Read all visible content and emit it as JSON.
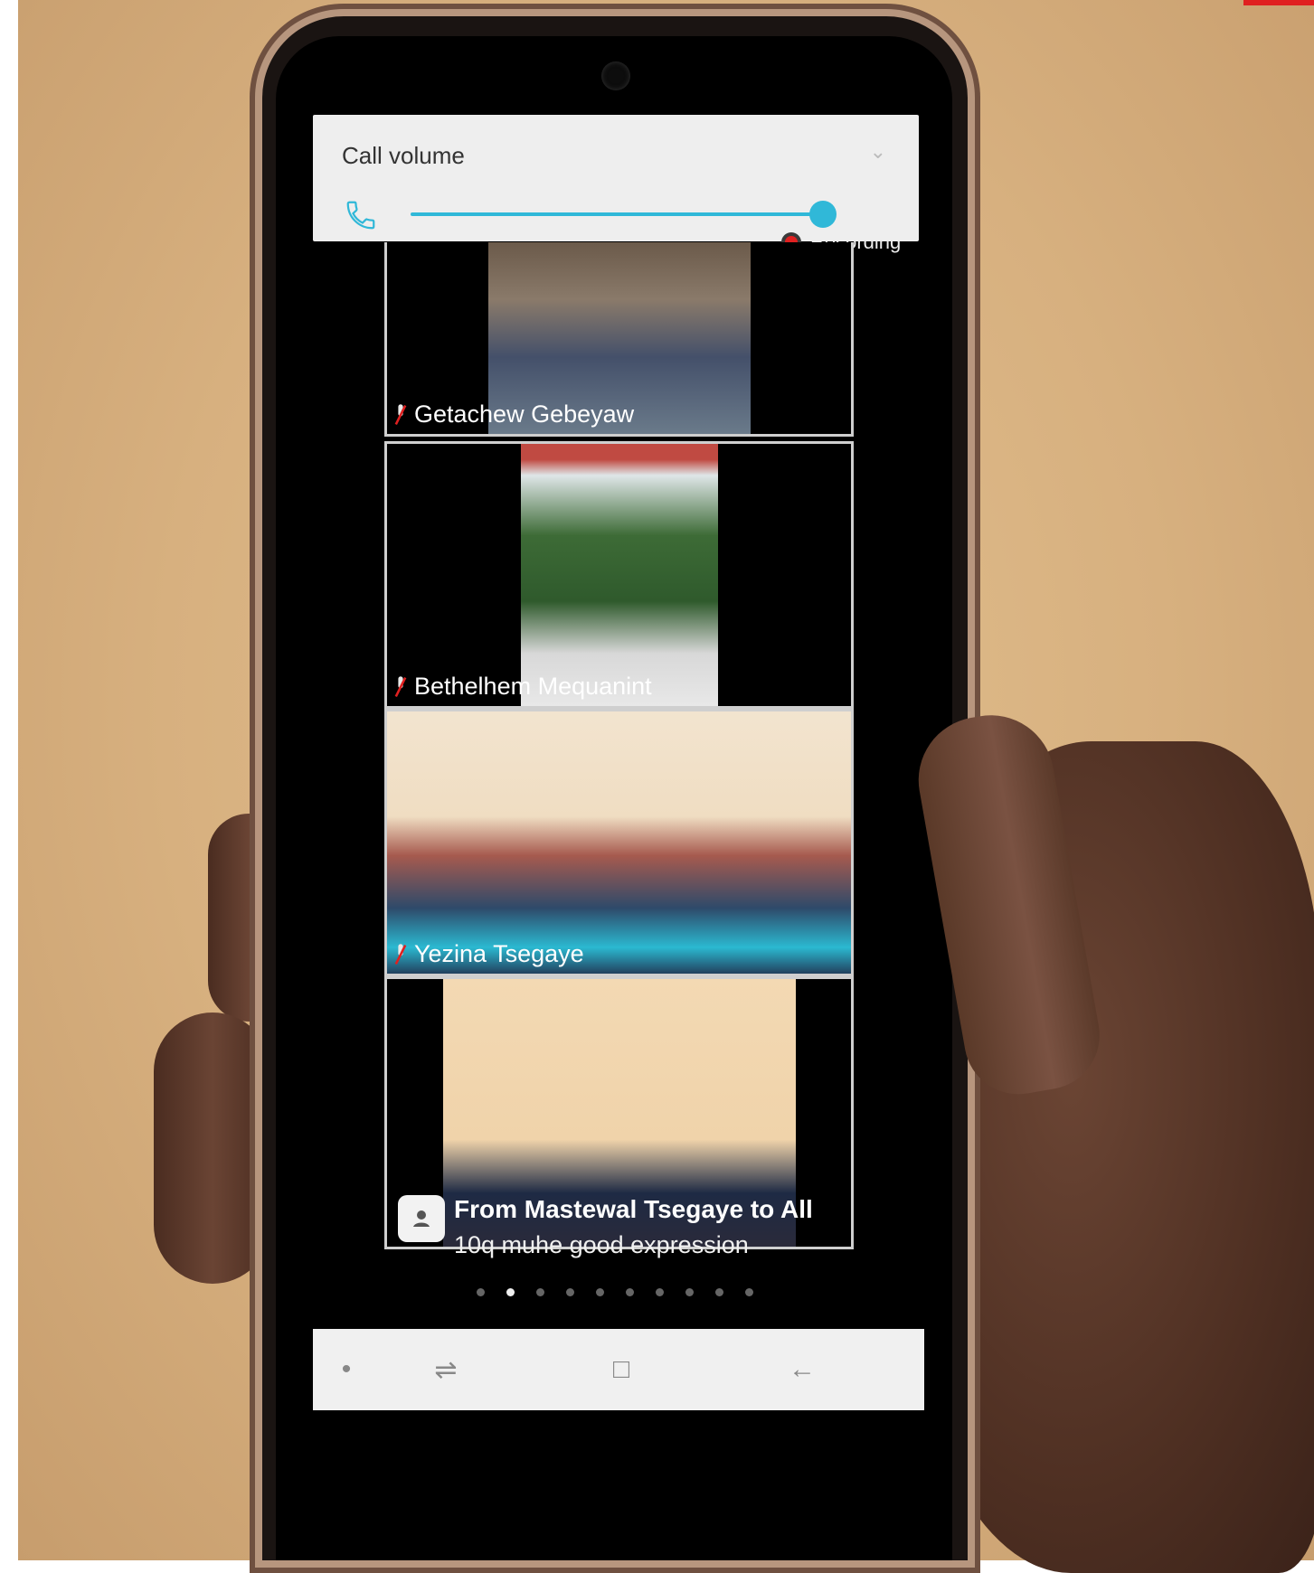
{
  "volume_panel": {
    "title": "Call volume",
    "level_percent": 97,
    "icons": {
      "phone": "phone-icon",
      "collapse": "chevron-down-icon"
    }
  },
  "recording": {
    "label": "Recording"
  },
  "participants": [
    {
      "name": "Getachew Gebeyaw"
    },
    {
      "name": "Bethelhem Mequanint"
    },
    {
      "name": "Yezina Tsegaye"
    },
    {
      "name": ""
    }
  ],
  "chat_notification": {
    "sender": "From Mastewal Tsegaye to All",
    "message": "10q muhe good expression"
  },
  "pagination": {
    "total_pages": 10,
    "current_page": 2
  },
  "nav_bar": {
    "icons": [
      "dot-icon",
      "recent-apps-icon",
      "home-icon",
      "back-icon"
    ]
  },
  "colors": {
    "accent": "#30b8d8",
    "recording": "#e02020"
  }
}
